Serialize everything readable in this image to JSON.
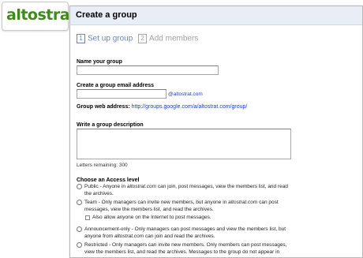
{
  "logo": {
    "text": "altostrat"
  },
  "header": {
    "title": "Create a group"
  },
  "steps": [
    {
      "num": "1",
      "label": "Set up group"
    },
    {
      "num": "2",
      "label": "Add members"
    }
  ],
  "form": {
    "name_label": "Name your group",
    "name_value": "",
    "email_label": "Create a group email address",
    "email_value": "",
    "email_domain": "@altostrat.com",
    "web_label": "Group web address:",
    "web_url": "http://groups.google.com/a/altostrat.com/group/",
    "desc_label": "Write a group description",
    "desc_value": "",
    "letters_remaining": "Letters remaining: 300",
    "access_label": "Choose an Access level",
    "access_options": [
      {
        "line1_pre": "Public - Anyone in ",
        "line1_em": "altostrat.com",
        "line1_post": " can join, post messages, view the members list, and read",
        "line2": "the archives."
      },
      {
        "line1_pre": "Team - Only managers can invite new members, but anyone in ",
        "line1_em": "altostrat.com",
        "line1_post": " can post",
        "line2": "messages, view the members list, and read the archives."
      },
      {
        "line1_pre": "Announcement-only - Only managers can post messages and view the members list, but",
        "line1_em": "",
        "line1_post": "",
        "line2_pre": "anyone from ",
        "line2_em": "altostrat.com",
        "line2_post": " can join and read the archives."
      },
      {
        "line1_pre": "Restricted - Only managers can invite new members. Only members can post messages,",
        "line1_em": "",
        "line1_post": "",
        "line2": "view the members list, and read the archives. Messages to the group do not appear in"
      }
    ],
    "team_checkbox_label": "Also allow anyone on the Internet to post messages."
  }
}
